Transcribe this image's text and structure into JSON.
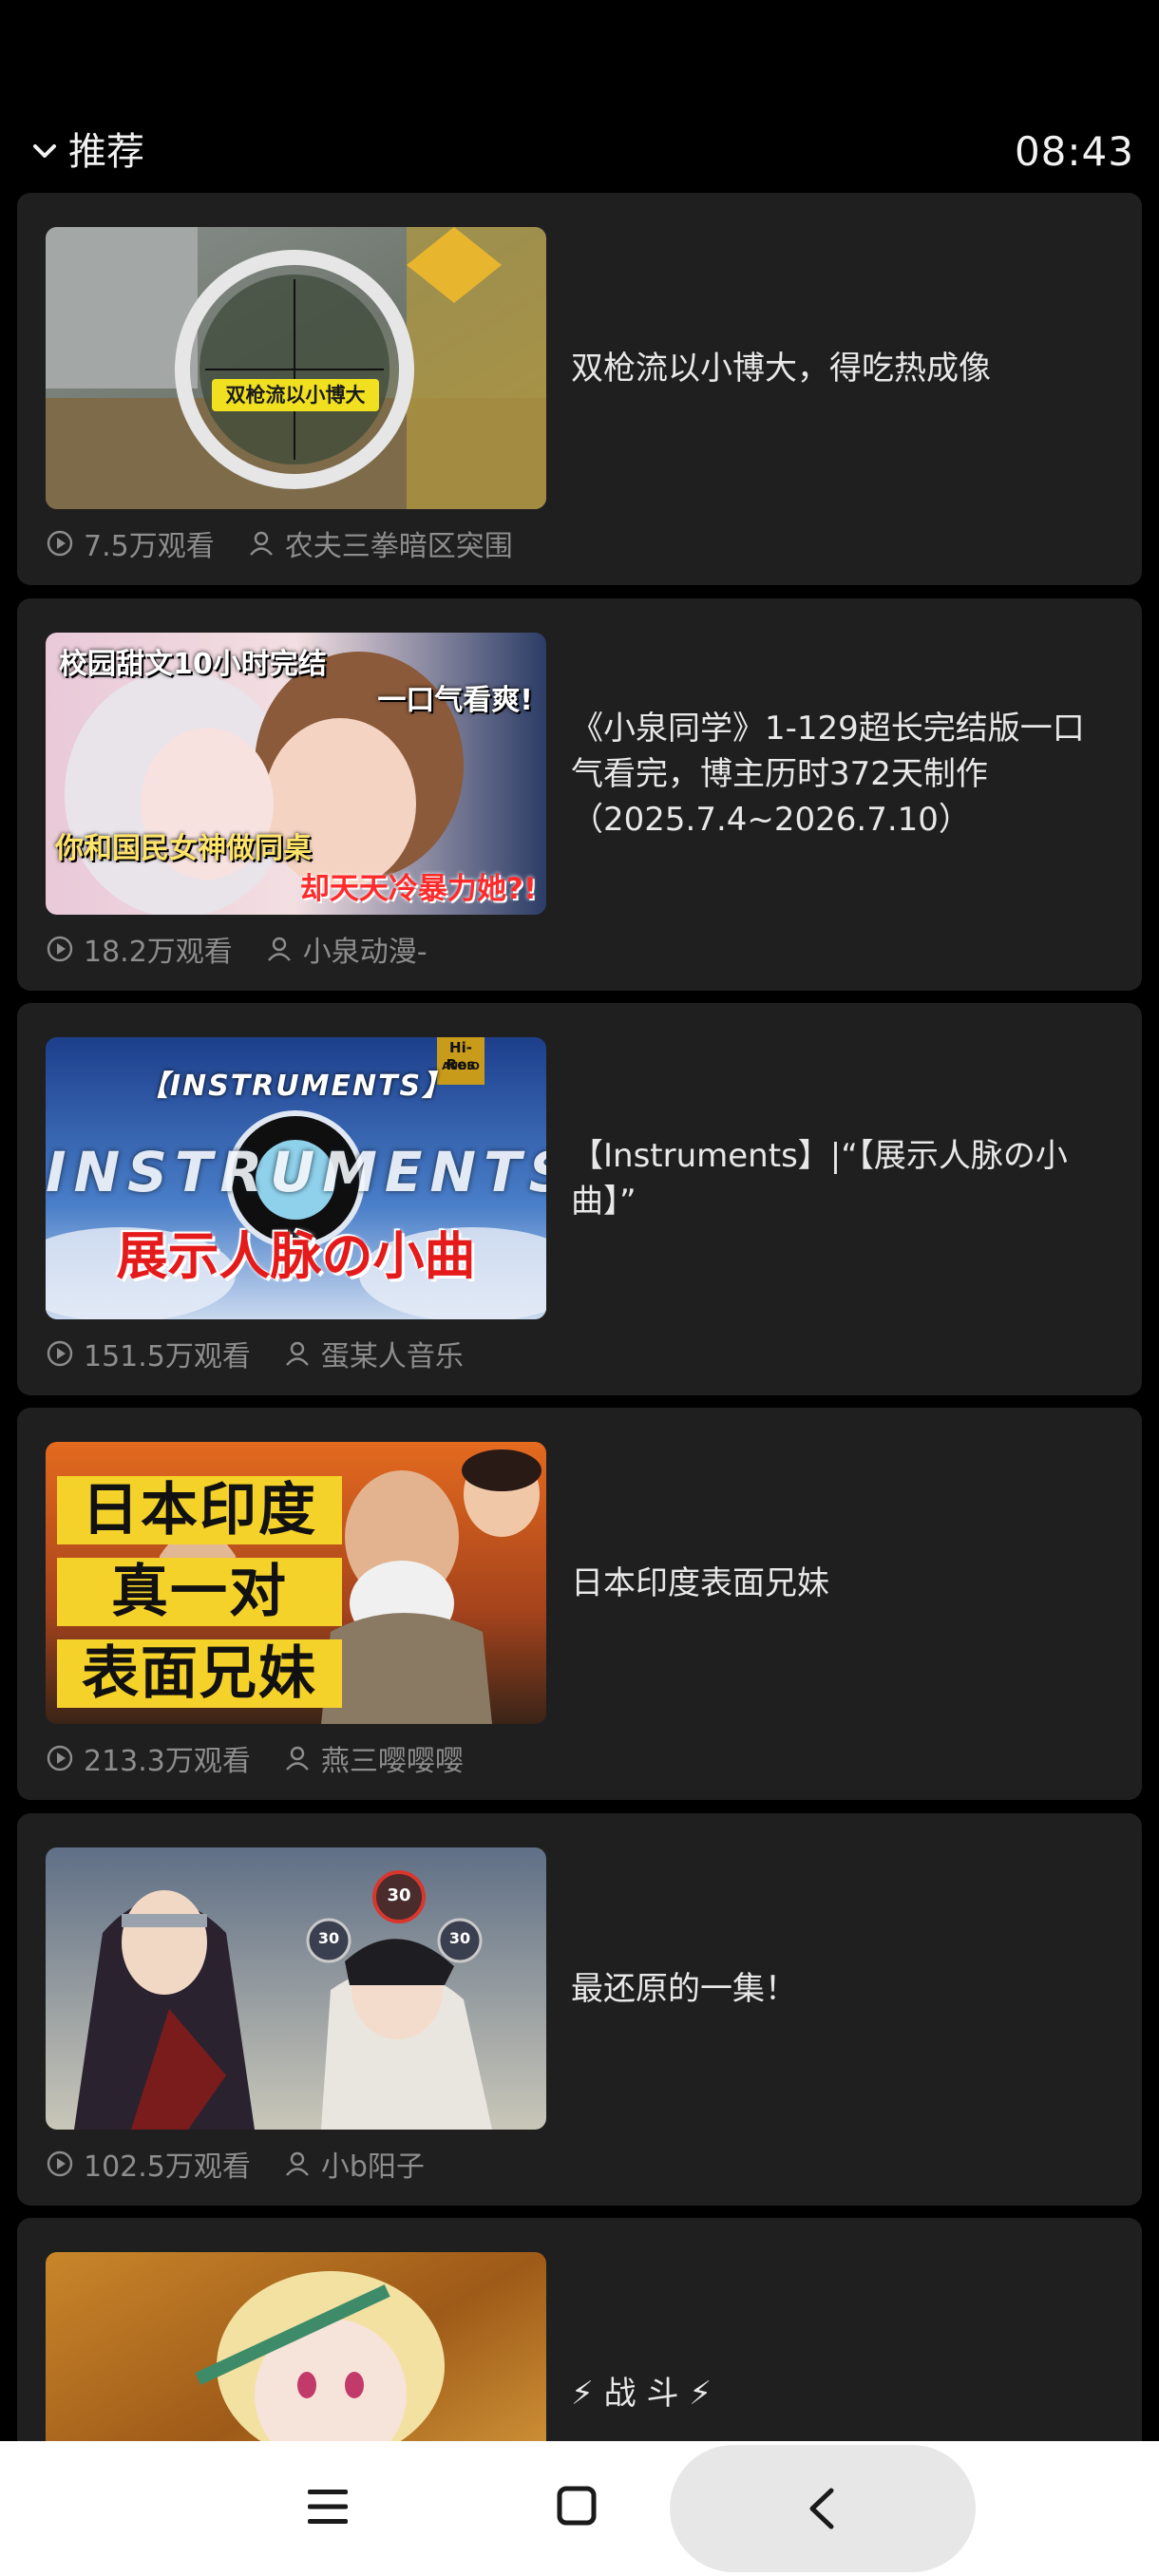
{
  "header": {
    "title": "推荐",
    "time": "08:43"
  },
  "videos": [
    {
      "title": "双枪流以小博大，得吃热成像",
      "views": "7.5万观看",
      "author": "农夫三拳暗区突围",
      "thumb_text": [
        "双枪流以小博大"
      ]
    },
    {
      "title": "《小泉同学》1-129超长完结版一口气看完，博主历时372天制作（2025.7.4~2026.7.10）",
      "views": "18.2万观看",
      "author": "小泉动漫-",
      "thumb_text": [
        "校园甜文10小时完结",
        "一口气看爽!",
        "你和国民女神做同桌",
        "却天天冷暴力她?!"
      ]
    },
    {
      "title": "【Instruments】|“【展示人脉の小曲】”",
      "views": "151.5万观看",
      "author": "蛋某人音乐",
      "thumb_text": [
        "【INSTRUMENTS】",
        "INSTRUMENTS",
        "展示人脉の小曲",
        "Hi-Res",
        "AUDIO"
      ]
    },
    {
      "title": "日本印度表面兄妹",
      "views": "213.3万观看",
      "author": "燕三嘤嘤嘤",
      "thumb_text": [
        "日本印度",
        "真一对",
        "表面兄妹"
      ]
    },
    {
      "title": "最还原的一集！",
      "views": "102.5万观看",
      "author": "小b阳子",
      "thumb_text": [
        "30",
        "30",
        "30"
      ]
    },
    {
      "title": "⚡ 战 斗 ⚡",
      "views": "",
      "author": "",
      "thumb_text": []
    }
  ],
  "icons": {
    "dropdown": "chevron-down-icon",
    "views": "play-circle-icon",
    "author": "person-icon",
    "nav_menu": "menu-icon",
    "nav_home": "home-square-icon",
    "nav_back": "back-chevron-icon"
  }
}
